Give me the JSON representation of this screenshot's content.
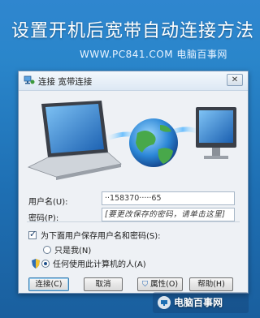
{
  "banner": {
    "title": "设置开机后宽带自动连接方法",
    "subtitle": "WWW.PC841.COM 电脑百事网"
  },
  "dialog": {
    "title": "连接 宽带连接",
    "close_glyph": "✕",
    "username_label": "用户名(U):",
    "username_value": "··158370·····65",
    "password_label": "密码(P):",
    "password_placeholder": "[要更改保存的密码，请单击这里]",
    "save_checkbox_label": "为下面用户保存用户名和密码(S):",
    "save_checked": true,
    "radio_me_label": "只是我(N)",
    "radio_anyone_label": "任何使用此计算机的人(A)",
    "radio_selected": "anyone",
    "buttons": {
      "connect": "连接(C)",
      "cancel": "取消",
      "properties": "属性(O)",
      "help": "帮助(H)"
    }
  },
  "watermark": {
    "text": "电脑百事网",
    "icon": "pc841-logo-icon"
  },
  "colors": {
    "banner_bg": "#2a86cb",
    "dialog_bg": "#eef1f5",
    "accent": "#3c7fb1"
  }
}
